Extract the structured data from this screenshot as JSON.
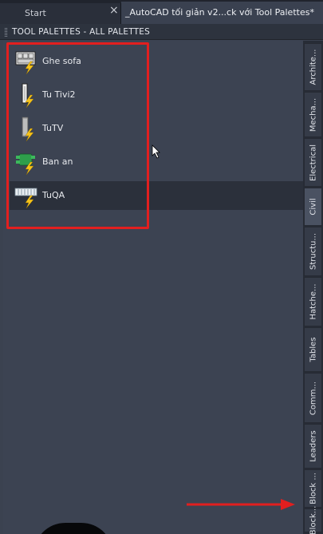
{
  "tabs": {
    "start": "Start",
    "document": "_AutoCAD tối giản v2...ck với Tool Palettes*"
  },
  "palette": {
    "title": "TOOL PALETTES - ALL PALETTES",
    "tools": [
      {
        "label": "Ghe sofa",
        "icon": "sofa-block-icon"
      },
      {
        "label": "Tu Tivi2",
        "icon": "tv-cabinet-block-icon"
      },
      {
        "label": "TuTV",
        "icon": "tv-stand-block-icon"
      },
      {
        "label": "Ban an",
        "icon": "dining-table-block-icon"
      },
      {
        "label": "TuQA",
        "icon": "wardrobe-block-icon"
      }
    ],
    "vertical_tabs": [
      "Archite...",
      "Mecha...",
      "Electrical",
      "Civil",
      "Structu...",
      "Hatche...",
      "Tables",
      "Comm...",
      "Leaders",
      "Block ...",
      "Block..."
    ]
  },
  "colors": {
    "highlight": "#e21f1f",
    "lightning": "#f7c31a",
    "panel": "#3b4250"
  }
}
